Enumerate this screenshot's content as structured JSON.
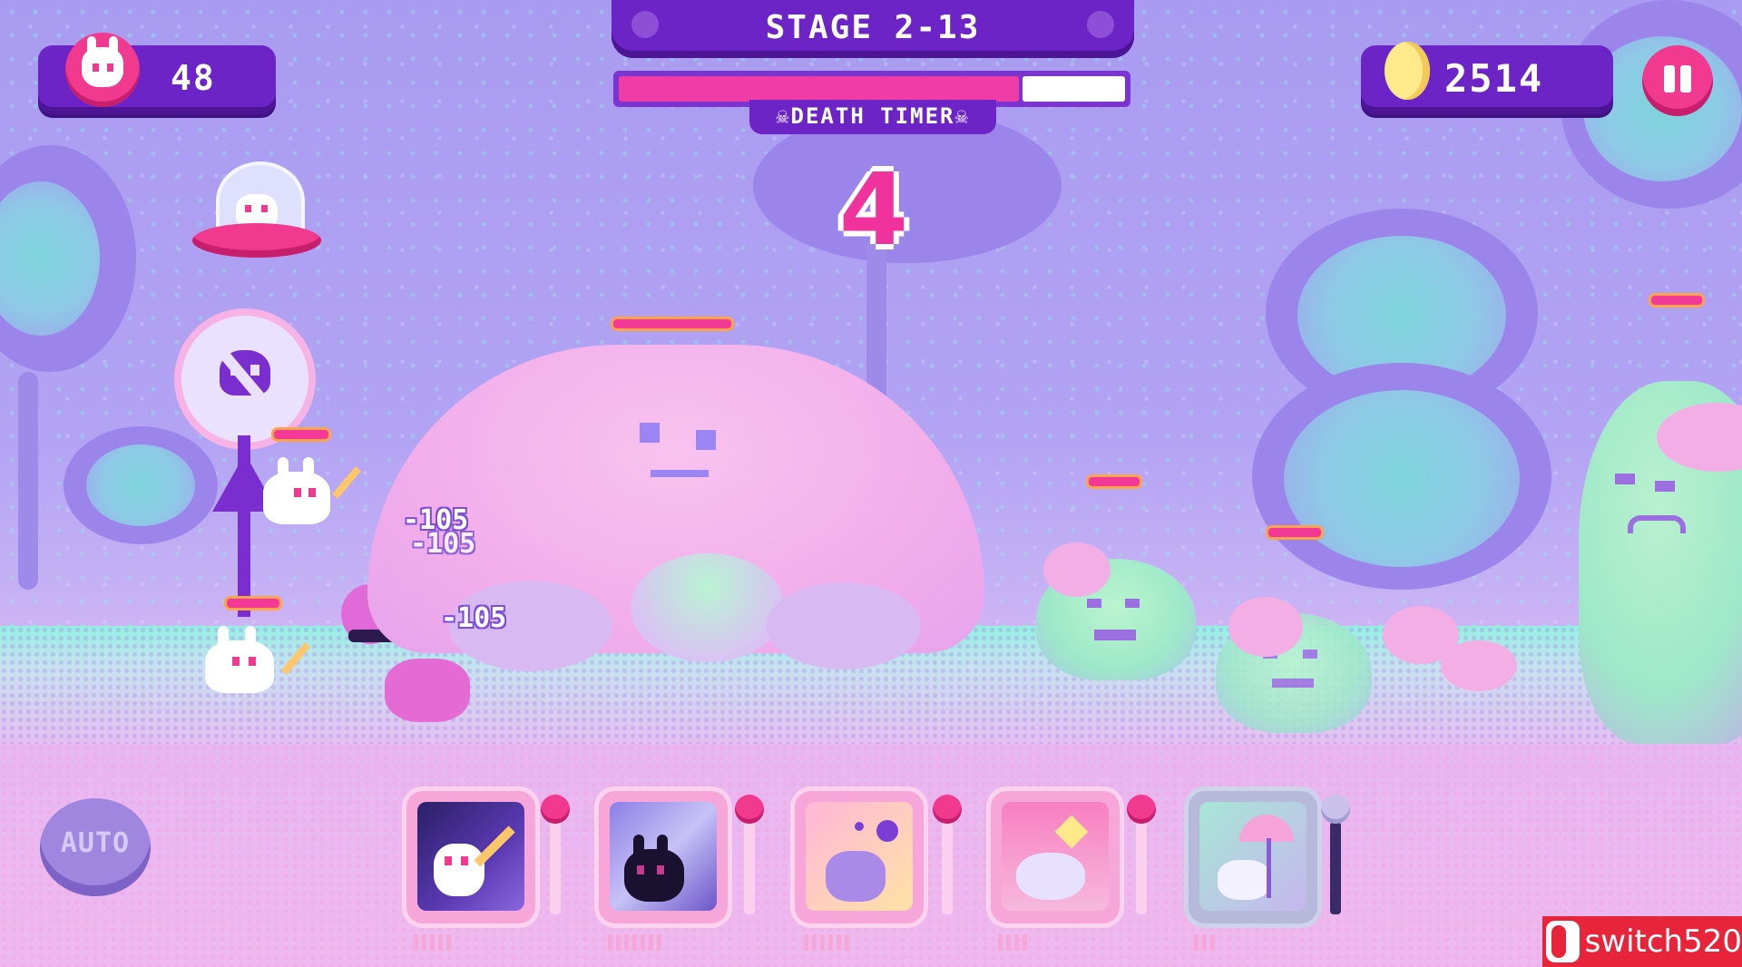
{
  "game": {
    "lives_count": "48",
    "stage_title": "STAGE 2-13",
    "death_timer_label": "☠DEATH TIMER☠",
    "death_timer_progress": 0.79,
    "countdown": "4",
    "coins": "2514"
  },
  "combat": {
    "damage_numbers": [
      "-105",
      "-105",
      "-105"
    ]
  },
  "controls": {
    "auto_label": "AUTO",
    "pause_icon": "pause-icon"
  },
  "skills": [
    {
      "name": "pickaxe-bunny-skill",
      "pips": 5,
      "ready": true
    },
    {
      "name": "dark-bunny-skill",
      "pips": 7,
      "ready": true
    },
    {
      "name": "bubble-bunny-skill",
      "pips": 6,
      "ready": true
    },
    {
      "name": "sparkle-bunny-skill",
      "pips": 4,
      "ready": true
    },
    {
      "name": "umbrella-bunny-skill",
      "pips": 3,
      "ready": false
    }
  ],
  "watermark": {
    "text": "switch520"
  },
  "colors": {
    "hud_purple": "#6d24c6",
    "accent_pink": "#f0398f",
    "sky": "#a99bf1",
    "ground_teal": "#94f0e2"
  }
}
